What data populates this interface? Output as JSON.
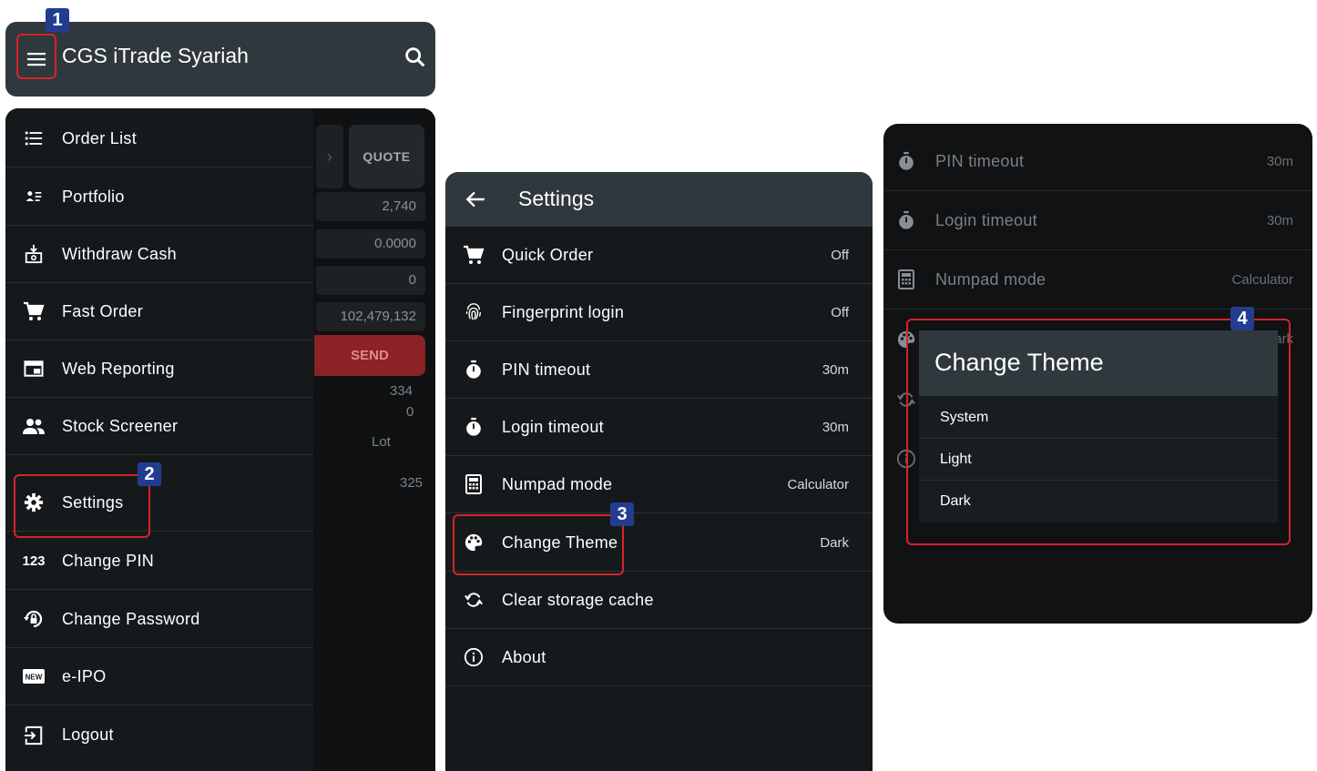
{
  "appbar": {
    "title": "CGS iTrade Syariah"
  },
  "drawer": {
    "items": [
      {
        "label": "Order List",
        "icon": "list-icon"
      },
      {
        "label": "Portfolio",
        "icon": "portfolio-icon"
      },
      {
        "label": "Withdraw Cash",
        "icon": "withdraw-cash-icon"
      },
      {
        "label": "Fast Order",
        "icon": "cart-icon"
      },
      {
        "label": "Web Reporting",
        "icon": "web-reporting-icon"
      },
      {
        "label": "Stock Screener",
        "icon": "people-icon"
      },
      {
        "label": "Settings",
        "icon": "gear-icon"
      },
      {
        "label": "Change PIN",
        "icon": "pin-123-icon"
      },
      {
        "label": "Change Password",
        "icon": "lock-reset-icon"
      },
      {
        "label": "e-IPO",
        "icon": "new-badge-icon"
      },
      {
        "label": "Logout",
        "icon": "logout-icon"
      }
    ]
  },
  "background_screen": {
    "quote_label": "QUOTE",
    "cells": [
      "2,740",
      "0.0000",
      "0",
      "102,479,132"
    ],
    "send_label": "SEND",
    "text_334": "334",
    "text_0": "0",
    "lot_label": "Lot",
    "text_325": "325"
  },
  "settings": {
    "title": "Settings",
    "rows": [
      {
        "label": "Quick Order",
        "value": "Off",
        "icon": "quick-order-cart-icon"
      },
      {
        "label": "Fingerprint login",
        "value": "Off",
        "icon": "fingerprint-icon"
      },
      {
        "label": "PIN timeout",
        "value": "30m",
        "icon": "stopwatch-icon"
      },
      {
        "label": "Login timeout",
        "value": "30m",
        "icon": "stopwatch-icon"
      },
      {
        "label": "Numpad mode",
        "value": "Calculator",
        "icon": "calculator-icon"
      },
      {
        "label": "Change Theme",
        "value": "Dark",
        "icon": "palette-icon"
      },
      {
        "label": "Clear storage cache",
        "value": "",
        "icon": "refresh-icon"
      },
      {
        "label": "About",
        "value": "",
        "icon": "info-icon"
      }
    ]
  },
  "theme_panel": {
    "rows": [
      {
        "label": "PIN timeout",
        "value": "30m"
      },
      {
        "label": "Login timeout",
        "value": "30m"
      },
      {
        "label": "Numpad mode",
        "value": "Calculator"
      }
    ],
    "partial_value": "ark",
    "dialog": {
      "title": "Change Theme",
      "options": [
        "System",
        "Light",
        "Dark"
      ]
    }
  },
  "badges": [
    "1",
    "2",
    "3",
    "4"
  ],
  "colors": {
    "appbar": "#2f383d",
    "drawer_bg": "#16191b",
    "highlight": "#d6232b",
    "badge": "#223d8f",
    "send": "#8a2226"
  }
}
